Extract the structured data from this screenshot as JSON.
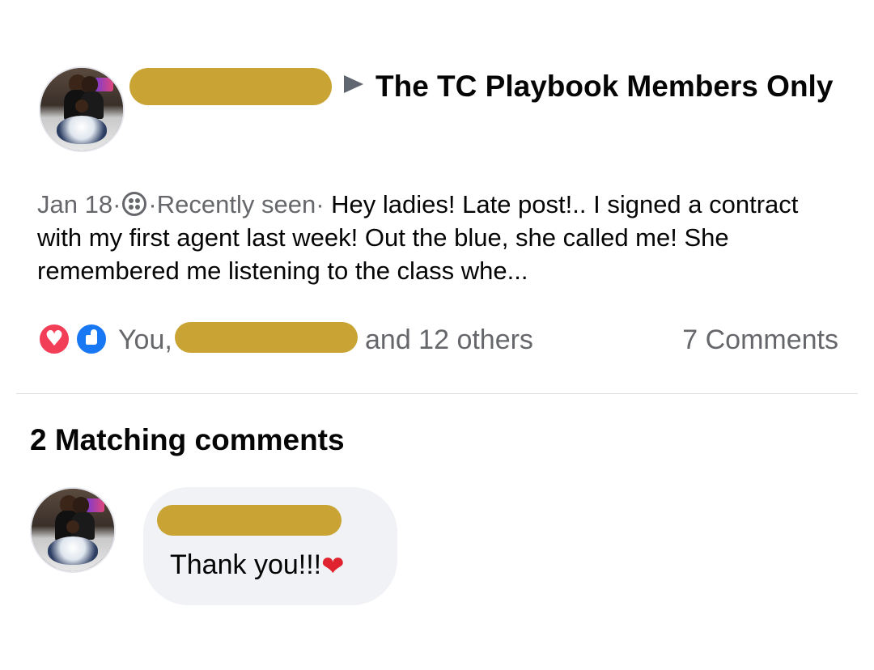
{
  "post": {
    "author_redacted": true,
    "group_name": "The TC Playbook Members Only",
    "date": "Jan 18",
    "separator": "·",
    "status": "Recently seen",
    "excerpt": "Hey ladies! Late post!.. I signed a contract with my first agent last week! Out the blue, she called me! She remembered me listening to the class whe...",
    "audience_icon": "friends-group-icon"
  },
  "reactions": {
    "icons": [
      "love-reaction-icon",
      "like-reaction-icon"
    ],
    "prefix": "You,",
    "suffix": "and 12 others",
    "comments_count": "7 Comments"
  },
  "matching": {
    "title": "2 Matching comments",
    "comments": [
      {
        "author_redacted": true,
        "text": "Thank you!!!",
        "emoji": "❤"
      }
    ]
  },
  "colors": {
    "redaction": "#c9a434",
    "muted_text": "#65676b",
    "like_blue": "#1877f2",
    "love_red": "#f33e58",
    "bubble_bg": "#f0f2f5"
  }
}
